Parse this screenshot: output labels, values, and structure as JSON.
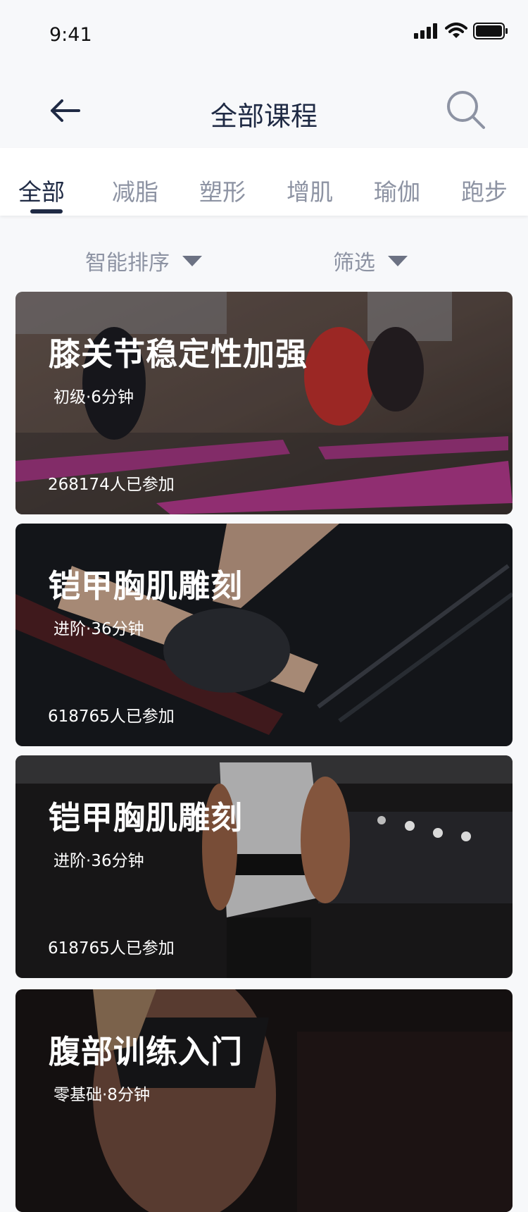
{
  "status_bar": {
    "time": "9:41"
  },
  "header": {
    "title": "全部课程"
  },
  "tabs": [
    {
      "label": "全部",
      "active": true
    },
    {
      "label": "减脂"
    },
    {
      "label": "塑形"
    },
    {
      "label": "增肌"
    },
    {
      "label": "瑜伽"
    },
    {
      "label": "跑步"
    }
  ],
  "filters": {
    "sort_label": "智能排序",
    "filter_label": "筛选"
  },
  "courses": [
    {
      "title": "膝关节稳定性加强",
      "meta": "初级·6分钟",
      "participants": "268174人已参加"
    },
    {
      "title": "铠甲胸肌雕刻",
      "meta": "进阶·36分钟",
      "participants": "618765人已参加"
    },
    {
      "title": "铠甲胸肌雕刻",
      "meta": "进阶·36分钟",
      "participants": "618765人已参加"
    },
    {
      "title": "腹部训练入门",
      "meta": "零基础·8分钟",
      "participants": ""
    }
  ],
  "colors": {
    "primary": "#1f2a44",
    "tab_inactive": "#8d93a3",
    "background": "#f7f8fa"
  },
  "icons": [
    "back-arrow-icon",
    "search-icon",
    "signal-icon",
    "wifi-icon",
    "battery-icon",
    "triangle-down-icon"
  ]
}
